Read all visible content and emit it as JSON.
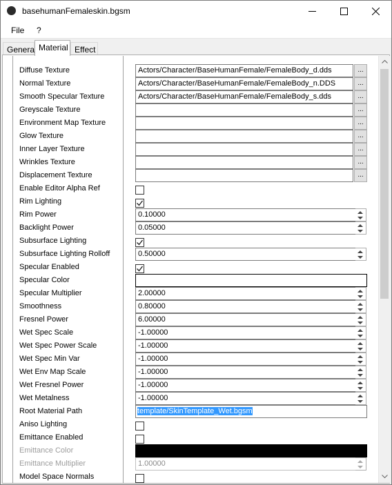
{
  "window": {
    "title": "basehumanFemaleskin.bgsm"
  },
  "menu": {
    "file": "File",
    "help": "?"
  },
  "tabs": [
    {
      "label": "General"
    },
    {
      "label": "Material"
    },
    {
      "label": "Effect"
    }
  ],
  "active_tab": "Material",
  "fields": {
    "diffuse_texture": {
      "label": "Diffuse Texture",
      "value": "Actors/Character/BaseHumanFemale/FemaleBody_d.dds"
    },
    "normal_texture": {
      "label": "Normal Texture",
      "value": "Actors/Character/BaseHumanFemale/FemaleBody_n.DDS"
    },
    "smooth_specular_texture": {
      "label": "Smooth Specular Texture",
      "value": "Actors/Character/BaseHumanFemale/FemaleBody_s.dds"
    },
    "greyscale_texture": {
      "label": "Greyscale Texture",
      "value": ""
    },
    "environment_map_texture": {
      "label": "Environment Map Texture",
      "value": ""
    },
    "glow_texture": {
      "label": "Glow Texture",
      "value": ""
    },
    "inner_layer_texture": {
      "label": "Inner Layer Texture",
      "value": ""
    },
    "wrinkles_texture": {
      "label": "Wrinkles Texture",
      "value": ""
    },
    "displacement_texture": {
      "label": "Displacement Texture",
      "value": ""
    },
    "enable_editor_alpha_ref": {
      "label": "Enable Editor Alpha Ref",
      "checked": false
    },
    "rim_lighting": {
      "label": "Rim Lighting",
      "checked": true
    },
    "rim_power": {
      "label": "Rim Power",
      "value": "0.10000"
    },
    "backlight_power": {
      "label": "Backlight Power",
      "value": "0.05000"
    },
    "subsurface_lighting": {
      "label": "Subsurface Lighting",
      "checked": true
    },
    "subsurface_lighting_rolloff": {
      "label": "Subsurface Lighting Rolloff",
      "value": "0.50000"
    },
    "specular_enabled": {
      "label": "Specular Enabled",
      "checked": true
    },
    "specular_color": {
      "label": "Specular Color",
      "color": "#ffffff"
    },
    "specular_multiplier": {
      "label": "Specular Multiplier",
      "value": "2.00000"
    },
    "smoothness": {
      "label": "Smoothness",
      "value": "0.80000"
    },
    "fresnel_power": {
      "label": "Fresnel Power",
      "value": "6.00000"
    },
    "wet_spec_scale": {
      "label": "Wet Spec Scale",
      "value": "-1.00000"
    },
    "wet_spec_power_scale": {
      "label": "Wet Spec Power Scale",
      "value": "-1.00000"
    },
    "wet_spec_min_var": {
      "label": "Wet Spec Min Var",
      "value": "-1.00000"
    },
    "wet_env_map_scale": {
      "label": "Wet Env Map Scale",
      "value": "-1.00000"
    },
    "wet_fresnel_power": {
      "label": "Wet Fresnel Power",
      "value": "-1.00000"
    },
    "wet_metalness": {
      "label": "Wet Metalness",
      "value": "-1.00000"
    },
    "root_material_path": {
      "label": "Root Material Path",
      "value": "template/SkinTemplate_Wet.bgsm"
    },
    "aniso_lighting": {
      "label": "Aniso Lighting",
      "checked": false
    },
    "emittance_enabled": {
      "label": "Emittance Enabled",
      "checked": false
    },
    "emittance_color": {
      "label": "Emittance Color",
      "color": "#000000"
    },
    "emittance_multiplier": {
      "label": "Emittance Multiplier",
      "value": "1.00000"
    },
    "model_space_normals": {
      "label": "Model Space Normals",
      "checked": false
    }
  },
  "browse_label": "..."
}
